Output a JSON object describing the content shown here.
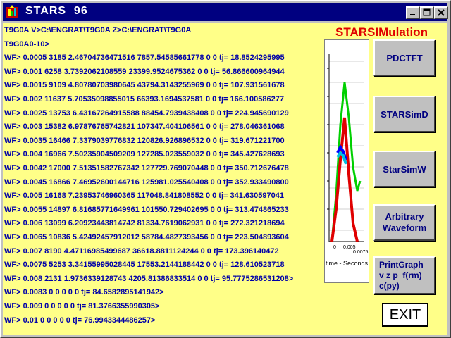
{
  "window": {
    "title": "STARS  96",
    "controls": {
      "minimize": "minimize-icon",
      "maximize": "maximize-icon",
      "close": "close-icon"
    }
  },
  "brand": {
    "title": "STARSIMulation",
    "color": "#e00000"
  },
  "output_lines": [
    "T9G0A V>C:\\ENGRAT\\T9G0A Z>C:\\ENGRAT\\T9G0A",
    "T9G0A0-10>",
    "WF> 0.0005 3185 2.46704736471516 7857.54585661778 0 0 tj= 18.8524295995",
    "WF> 0.001 6258 3.7392062108559 23399.9524675362 0 0 tj= 56.866600964944",
    "WF> 0.0015 9109 4.80780703980645 43794.3143255969 0 0 tj= 107.931561678",
    "WF> 0.002 11637 5.70535098855015 66393.1694537581 0 0 tj= 166.100586277",
    "WF> 0.0025 13753 6.43167264915588 88454.7939438408 0 0 tj= 224.945690129",
    "WF> 0.003 15382 6.97876765742821 107347.404106561 0 0 tj= 278.046361068",
    "WF> 0.0035 16466 7.3379039776832 120826.926896532 0 0 tj= 319.671221700",
    "WF> 0.004 16966 7.50235904509209 127285.023559032 0 0 tj= 345.427628693",
    "WF> 0.0042 17000 7.51351582767342 127729.769070448 0 0 tj= 350.712676478",
    "WF> 0.0045 16866 7.46952600144716 125981.025540408 0 0 tj= 352.933490800",
    "WF> 0.005 16168 7.23953746960365 117048.841808552 0 0 tj= 341.630597041",
    "WF> 0.0055 14897 6.81685771649961 101550.729402695 0 0 tj= 313.474865233",
    "WF> 0.006 13099 6.20923443814742 81334.7619062931 0 0 tj= 272.321218694",
    "WF> 0.0065 10836 5.42492457912012 58784.4827393456 0 0 tj= 223.504893604",
    "WF> 0.007 8190 4.47116985499687 36618.8811124244 0 0 tj= 173.396140472",
    "WF> 0.0075 5253 3.34155995028445 17553.2144188442 0 0 tj= 128.610523718",
    "WF> 0.008 2131 1.9736339128743 4205.81386833514 0 0 tj= 95.7775286531208>",
    "WF> 0.0083 0 0 0 0 0 tj= 84.6582895141942>",
    "WF> 0.009 0 0 0 0 0 tj= 81.3766355990305>",
    "WF> 0.01 0 0 0 0 0 tj= 76.9943344486257>"
  ],
  "mini_chart": {
    "x_ticks": [
      "0",
      "0.005",
      "0.0075"
    ],
    "xlabel": "time - Seconds",
    "colors": {
      "green": "#00d000",
      "red": "#e00000",
      "blue": "#0000ff",
      "cyan": "#00c0e0"
    }
  },
  "buttons": {
    "pdctft": "PDCTFT",
    "starsimd": "STARSimD",
    "starsimw": "StarSimW",
    "arbitrary": [
      "Arbitrary",
      "Waveform"
    ],
    "printgraph": [
      "PrintGraph",
      "v z p  f(rm)",
      "c(py)"
    ],
    "exit": "EXIT"
  }
}
